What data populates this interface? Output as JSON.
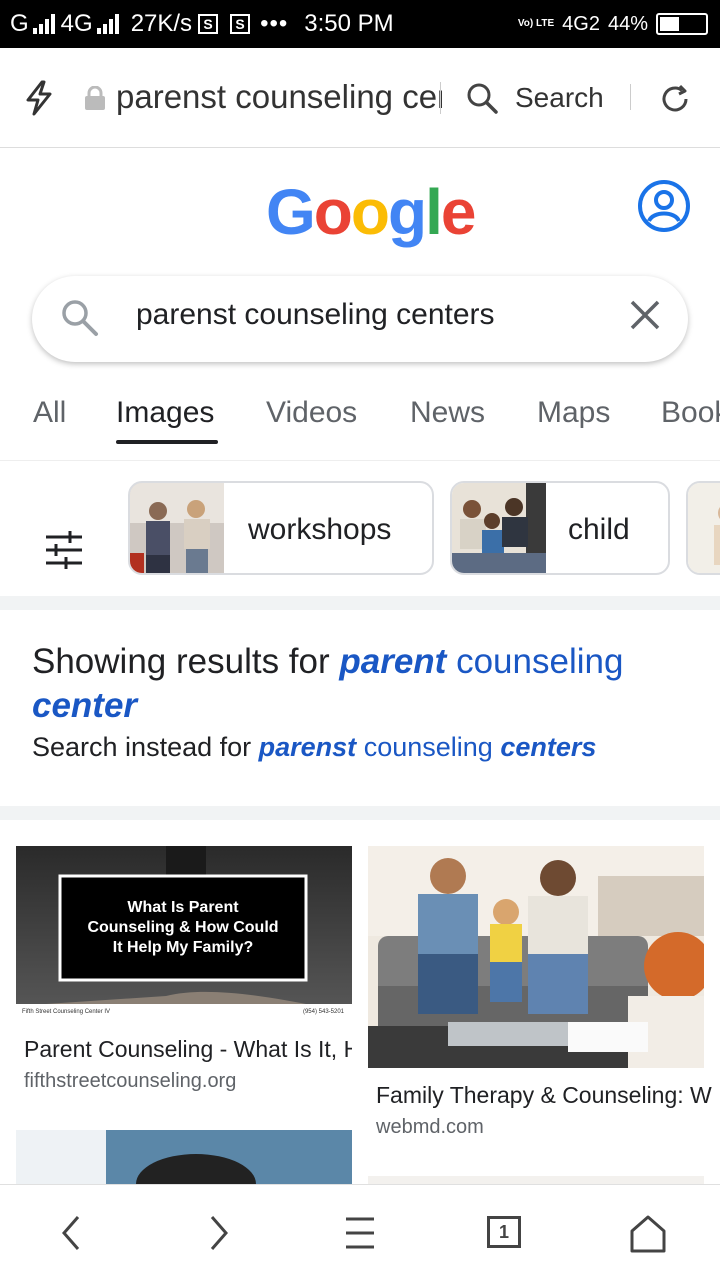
{
  "status_bar": {
    "carrier": "G",
    "network": "4G",
    "speed": "27K/s",
    "notif_icons": [
      "S",
      "S"
    ],
    "more": "•••",
    "time": "3:50 PM",
    "volte": "Vo) LTE",
    "net2": "4G2",
    "battery": "44%",
    "battery_level": 0.44
  },
  "browser": {
    "url": "parenst counseling centers - Google Search",
    "search_label": "Search"
  },
  "google": {
    "logo": [
      "G",
      "o",
      "o",
      "g",
      "l",
      "e"
    ],
    "logo_colors": [
      "#4285F4",
      "#EA4335",
      "#FBBC05",
      "#4285F4",
      "#34A853",
      "#EA4335"
    ],
    "query": "parenst counseling centers"
  },
  "tabs": [
    {
      "label": "All"
    },
    {
      "label": "Images"
    },
    {
      "label": "Videos"
    },
    {
      "label": "News"
    },
    {
      "label": "Maps"
    },
    {
      "label": "Books"
    }
  ],
  "chips": [
    {
      "label": "workshops"
    },
    {
      "label": "child"
    }
  ],
  "spelling": {
    "showing_prefix": "Showing results for",
    "corrected_1": "parent",
    "corrected_2": "counseling",
    "corrected_3": "center",
    "instead_prefix": "Search instead for",
    "original_1": "parenst",
    "original_2": "counseling",
    "original_3": "centers"
  },
  "results": [
    {
      "title": "Parent Counseling - What Is It, How Could It Help My Family?",
      "domain": "fifthstreetcounseling.org",
      "image_lines": [
        "What Is Parent",
        "Counseling & How Could",
        "It Help My Family?"
      ],
      "image_footer_left": "Fifth Street Counseling Center IV",
      "image_footer_right": "(954) 543-5201"
    },
    {
      "title": "Family Therapy & Counseling: What It Is",
      "domain": "webmd.com"
    }
  ],
  "bottom_nav": {
    "tab_count": "1"
  }
}
